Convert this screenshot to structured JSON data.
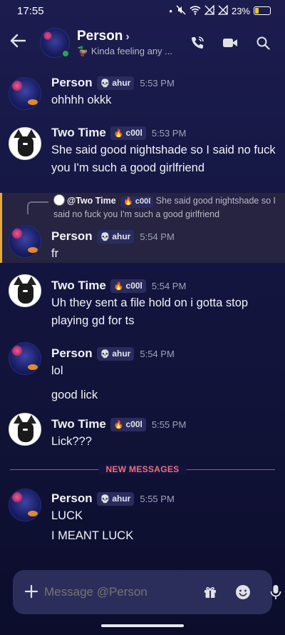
{
  "status_bar": {
    "time": "17:55",
    "battery": "23%"
  },
  "header": {
    "title": "Person",
    "chevron": "›",
    "status_emoji": "🦆",
    "status_text": "Kinda feeling any ...",
    "icons": [
      "back-arrow-icon",
      "phone-call-icon",
      "video-camera-icon",
      "search-icon"
    ]
  },
  "messages": [
    {
      "author": "Person",
      "tag": "ahur",
      "tag_icon": "skull",
      "time": "5:53 PM",
      "lines": [
        "ohhhh okkk"
      ]
    },
    {
      "author": "Two Time",
      "tag": "c00l",
      "tag_icon": "flame",
      "time": "5:53 PM",
      "lines": [
        "She said good nightshade so I said no fuck you I'm such a good girlfriend"
      ]
    },
    {
      "author": "Person",
      "tag": "ahur",
      "tag_icon": "skull",
      "time": "5:54 PM",
      "lines": [
        "fr"
      ],
      "reply": {
        "author": "@Two Time",
        "tag": "c00l",
        "text": "She said good nightshade so I said no fuck you I'm such a good girlfriend"
      }
    },
    {
      "author": "Two Time",
      "tag": "c00l",
      "tag_icon": "flame",
      "time": "5:54 PM",
      "lines": [
        "Uh they sent a file hold on i gotta stop playing gd for ts"
      ]
    },
    {
      "author": "Person",
      "tag": "ahur",
      "tag_icon": "skull",
      "time": "5:54 PM",
      "lines": [
        "lol",
        "good lick"
      ]
    },
    {
      "author": "Two Time",
      "tag": "c00l",
      "tag_icon": "flame",
      "time": "5:55 PM",
      "lines": [
        "Lick???"
      ]
    },
    {
      "author": "Person",
      "tag": "ahur",
      "tag_icon": "skull",
      "time": "5:55 PM",
      "lines": [
        "LUCK",
        "I MEANT LUCK"
      ]
    }
  ],
  "new_messages_label": "NEW MESSAGES",
  "composer": {
    "placeholder": "Message @Person",
    "icons": [
      "plus-icon",
      "gift-icon",
      "emoji-icon",
      "microphone-icon"
    ]
  },
  "colors": {
    "accent_reply": "#e5a93b",
    "new_messages": "#f26f72",
    "online": "#23a55a"
  }
}
